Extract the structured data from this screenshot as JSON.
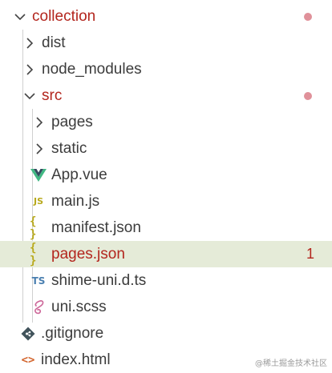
{
  "explorer": {
    "root": {
      "label": "collection",
      "expanded": true,
      "modified": true
    },
    "items": [
      {
        "label": "dist",
        "type": "folder",
        "expanded": false
      },
      {
        "label": "node_modules",
        "type": "folder",
        "expanded": false
      },
      {
        "label": "src",
        "type": "folder",
        "expanded": true,
        "modified": true
      },
      {
        "label": "pages",
        "type": "folder",
        "expanded": false
      },
      {
        "label": "static",
        "type": "folder",
        "expanded": false
      },
      {
        "label": "App.vue",
        "type": "file",
        "icon": "vue-icon"
      },
      {
        "label": "main.js",
        "type": "file",
        "icon": "js-icon",
        "icon_text": "JS"
      },
      {
        "label": "manifest.json",
        "type": "file",
        "icon": "json-icon",
        "icon_text": "{ }"
      },
      {
        "label": "pages.json",
        "type": "file",
        "icon": "json-icon",
        "icon_text": "{ }",
        "selected": true,
        "problems": "1"
      },
      {
        "label": "shime-uni.d.ts",
        "type": "file",
        "icon": "ts-icon",
        "icon_text": "TS"
      },
      {
        "label": "uni.scss",
        "type": "file",
        "icon": "scss-icon"
      },
      {
        "label": ".gitignore",
        "type": "file",
        "icon": "git-icon"
      },
      {
        "label": "index.html",
        "type": "file",
        "icon": "html-icon",
        "icon_text": "<>"
      }
    ]
  },
  "colors": {
    "modified": "#b3261e",
    "selected_bg": "#e5ebd8",
    "modified_dot": "#e0919a"
  },
  "watermark": "@稀土掘金技术社区"
}
